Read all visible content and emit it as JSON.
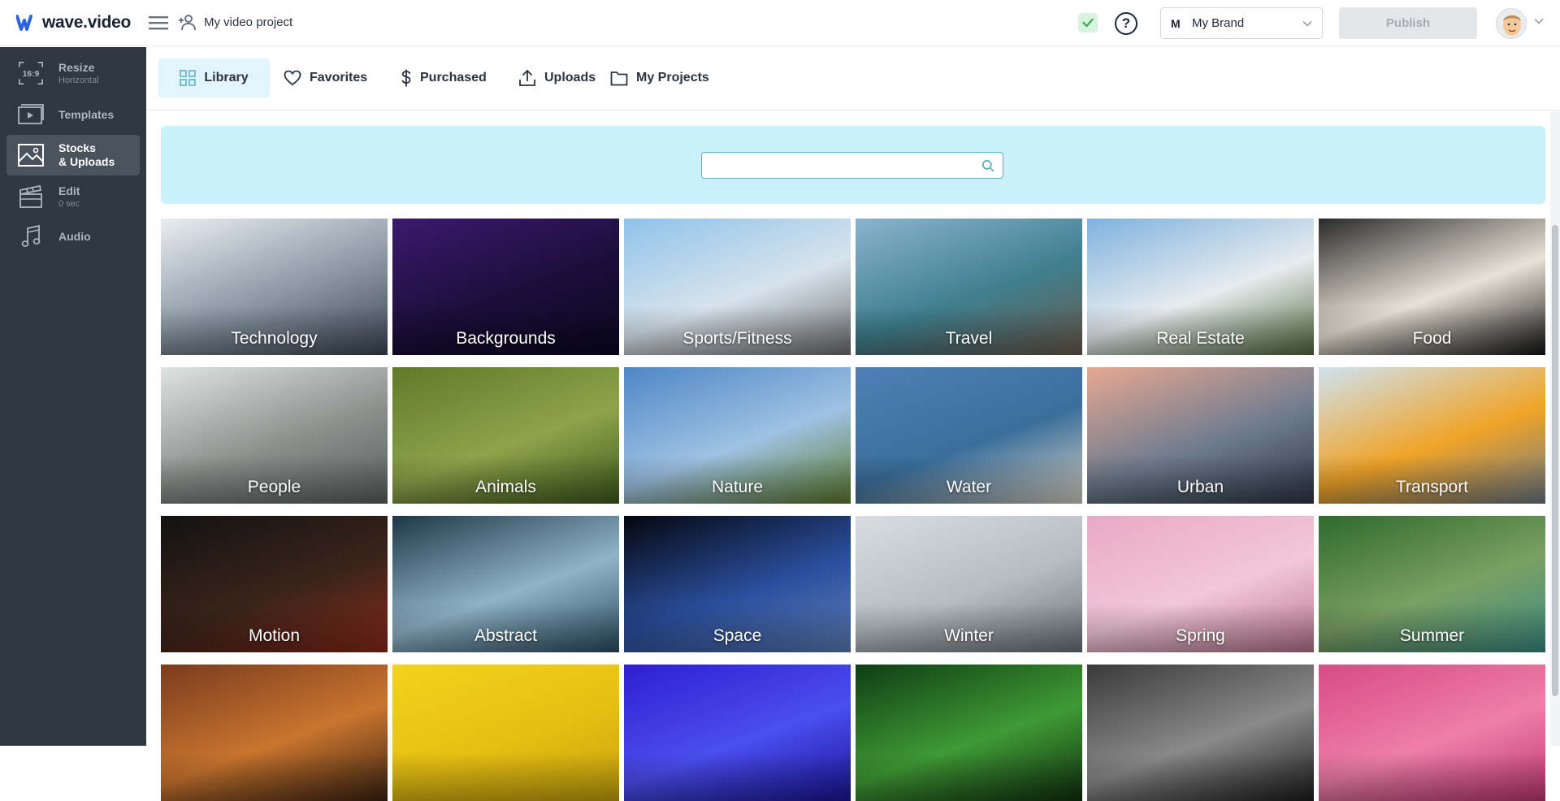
{
  "app": {
    "logo_text": "wave.video",
    "project_name": "My video project"
  },
  "topbar": {
    "brand_initial": "M",
    "brand_name": "My Brand",
    "publish_label": "Publish",
    "help_label": "?"
  },
  "sidebar": {
    "items": [
      {
        "label": "Resize",
        "sub": "Horizontal",
        "icon": "aspect-ratio-icon",
        "badge": "16:9"
      },
      {
        "label": "Templates",
        "sub": "",
        "icon": "templates-icon"
      },
      {
        "label": "Stocks",
        "label2": "& Uploads",
        "sub": "",
        "icon": "image-icon"
      },
      {
        "label": "Edit",
        "sub": "0 sec",
        "icon": "clapperboard-icon"
      },
      {
        "label": "Audio",
        "sub": "",
        "icon": "music-note-icon"
      }
    ]
  },
  "tabs": [
    {
      "label": "Library",
      "icon": "grid-icon"
    },
    {
      "label": "Favorites",
      "icon": "heart-icon"
    },
    {
      "label": "Purchased",
      "icon": "dollar-icon"
    },
    {
      "label": "Uploads",
      "icon": "upload-icon"
    },
    {
      "label": "My Projects",
      "icon": "folder-icon"
    }
  ],
  "search": {
    "value": "",
    "placeholder": ""
  },
  "categories": [
    {
      "label": "Technology",
      "colors": [
        "#e9eef2",
        "#8a96a3",
        "#3c4653"
      ]
    },
    {
      "label": "Backgrounds",
      "colors": [
        "#3a1a6e",
        "#1b0e3a",
        "#0a0620"
      ]
    },
    {
      "label": "Sports/Fitness",
      "colors": [
        "#8fc3ea",
        "#d7e3ec",
        "#6f6f70"
      ]
    },
    {
      "label": "Travel",
      "colors": [
        "#8bb3cf",
        "#3f7f8e",
        "#6b5a4c"
      ]
    },
    {
      "label": "Real Estate",
      "colors": [
        "#7fb2de",
        "#e7ecef",
        "#4f6a3d"
      ]
    },
    {
      "label": "Food",
      "colors": [
        "#2a2a2a",
        "#e8e2d6",
        "#141414"
      ]
    },
    {
      "label": "People",
      "colors": [
        "#dfe4e2",
        "#8c8f8c",
        "#59605e"
      ]
    },
    {
      "label": "Animals",
      "colors": [
        "#5f7a2b",
        "#8ea34a",
        "#3e5a1d"
      ]
    },
    {
      "label": "Nature",
      "colors": [
        "#4f86c6",
        "#9ec2e2",
        "#5d7c2c"
      ]
    },
    {
      "label": "Water",
      "colors": [
        "#4f7fb6",
        "#3b6f9b",
        "#d7d2c4"
      ]
    },
    {
      "label": "Urban",
      "colors": [
        "#e7a892",
        "#6f7c8f",
        "#2d3646"
      ]
    },
    {
      "label": "Transport",
      "colors": [
        "#cfe2f0",
        "#f0a427",
        "#6d7a86"
      ]
    },
    {
      "label": "Motion",
      "colors": [
        "#121212",
        "#3a241a",
        "#8c2a1a"
      ]
    },
    {
      "label": "Abstract",
      "colors": [
        "#1f3747",
        "#8fb3c7",
        "#2c4e61"
      ]
    },
    {
      "label": "Space",
      "colors": [
        "#04060e",
        "#2a4e9c",
        "#5d7fb9"
      ]
    },
    {
      "label": "Winter",
      "colors": [
        "#d9dde0",
        "#b5bcc2",
        "#6b7277"
      ]
    },
    {
      "label": "Spring",
      "colors": [
        "#e9a9c4",
        "#f2c7d8",
        "#b8778f"
      ]
    },
    {
      "label": "Summer",
      "colors": [
        "#2f6a2d",
        "#7aa063",
        "#3d8d84"
      ]
    },
    {
      "label": "",
      "colors": [
        "#7a3b1e",
        "#c9752e",
        "#3d2412"
      ]
    },
    {
      "label": "",
      "colors": [
        "#f2d31c",
        "#e5bf12",
        "#c9a20d"
      ]
    },
    {
      "label": "",
      "colors": [
        "#2f1fcf",
        "#4b4ef0",
        "#1a1598"
      ]
    },
    {
      "label": "",
      "colors": [
        "#0f3d14",
        "#3f9a35",
        "#11300f"
      ]
    },
    {
      "label": "",
      "colors": [
        "#3a3a3a",
        "#8a8a8a",
        "#1c1c1c"
      ]
    },
    {
      "label": "",
      "colors": [
        "#d84a86",
        "#ee7fa8",
        "#c03873"
      ]
    }
  ],
  "colors": {
    "sidebar_bg": "#2f3742",
    "accent": "#5eaec4",
    "banner_bg": "#c8f1fc",
    "tab_active_bg": "#e3f5fc"
  }
}
